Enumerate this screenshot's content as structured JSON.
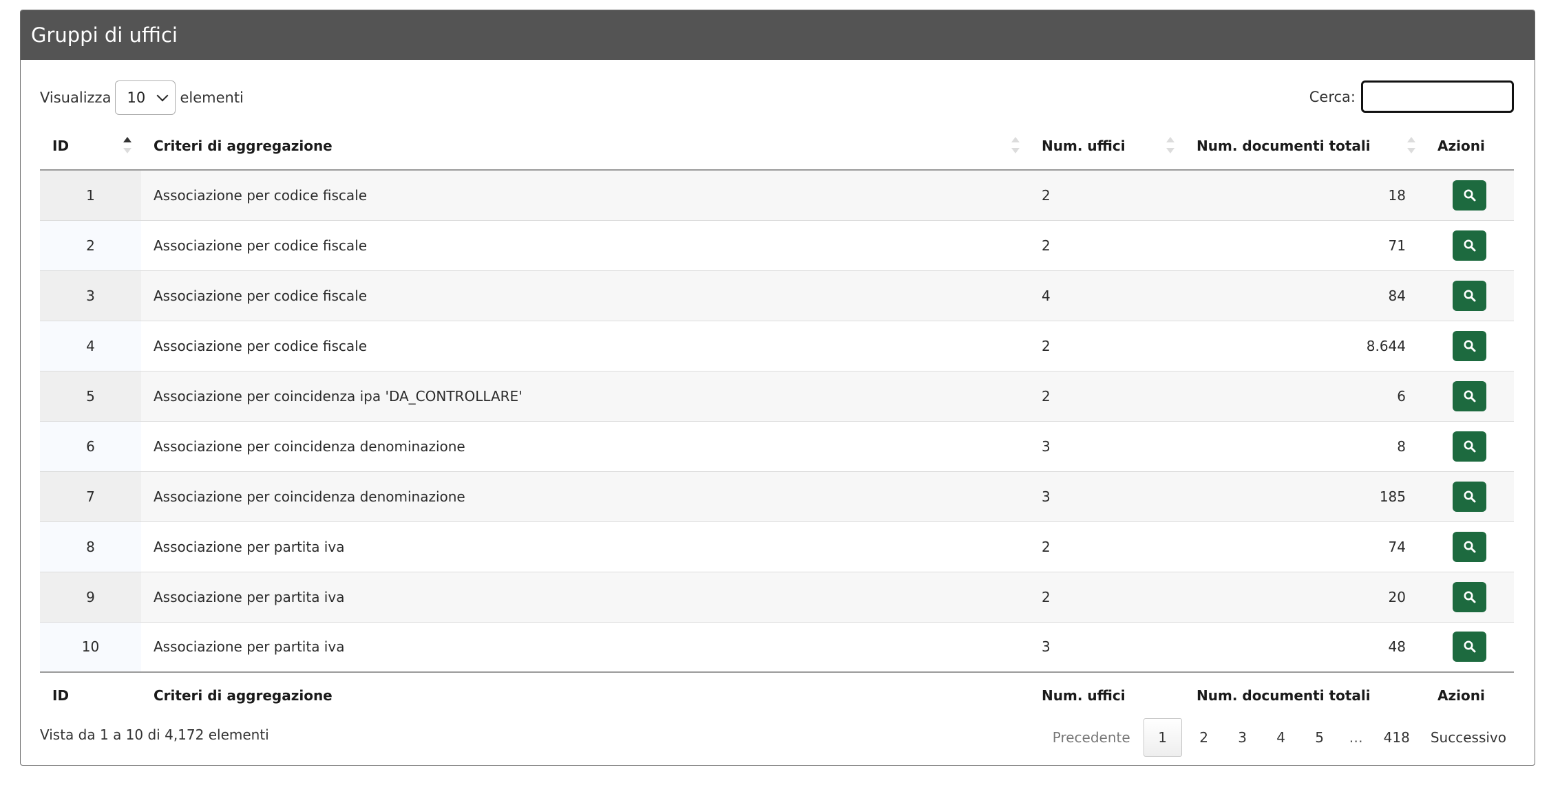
{
  "header": {
    "title": "Gruppi di uffici"
  },
  "length": {
    "prefix": "Visualizza",
    "value": "10",
    "suffix": "elementi"
  },
  "search": {
    "label": "Cerca:",
    "value": ""
  },
  "columns": {
    "id": "ID",
    "criteria": "Criteri di aggregazione",
    "num_offices": "Num. uffici",
    "num_docs": "Num. documenti totali",
    "actions": "Azioni"
  },
  "rows": [
    {
      "id": "1",
      "criteria": "Associazione per codice fiscale",
      "num_offices": "2",
      "num_docs": "18"
    },
    {
      "id": "2",
      "criteria": "Associazione per codice fiscale",
      "num_offices": "2",
      "num_docs": "71"
    },
    {
      "id": "3",
      "criteria": "Associazione per codice fiscale",
      "num_offices": "4",
      "num_docs": "84"
    },
    {
      "id": "4",
      "criteria": "Associazione per codice fiscale",
      "num_offices": "2",
      "num_docs": "8.644"
    },
    {
      "id": "5",
      "criteria": "Associazione per coincidenza ipa 'DA_CONTROLLARE'",
      "num_offices": "2",
      "num_docs": "6"
    },
    {
      "id": "6",
      "criteria": "Associazione per coincidenza denominazione",
      "num_offices": "3",
      "num_docs": "8"
    },
    {
      "id": "7",
      "criteria": "Associazione per coincidenza denominazione",
      "num_offices": "3",
      "num_docs": "185"
    },
    {
      "id": "8",
      "criteria": "Associazione per partita iva",
      "num_offices": "2",
      "num_docs": "74"
    },
    {
      "id": "9",
      "criteria": "Associazione per partita iva",
      "num_offices": "2",
      "num_docs": "20"
    },
    {
      "id": "10",
      "criteria": "Associazione per partita iva",
      "num_offices": "3",
      "num_docs": "48"
    }
  ],
  "info": "Vista da 1 a 10 di 4,172 elementi",
  "pagination": {
    "previous": "Precedente",
    "pages": [
      "1",
      "2",
      "3",
      "4",
      "5"
    ],
    "ellipsis": "…",
    "last": "418",
    "next": "Successivo"
  },
  "colors": {
    "header_bg": "#545454",
    "action_button": "#1d6a3f"
  },
  "icons": {
    "length_select": "chevron-down-icon",
    "row_action": "search-icon",
    "sort": "sort-icon"
  }
}
